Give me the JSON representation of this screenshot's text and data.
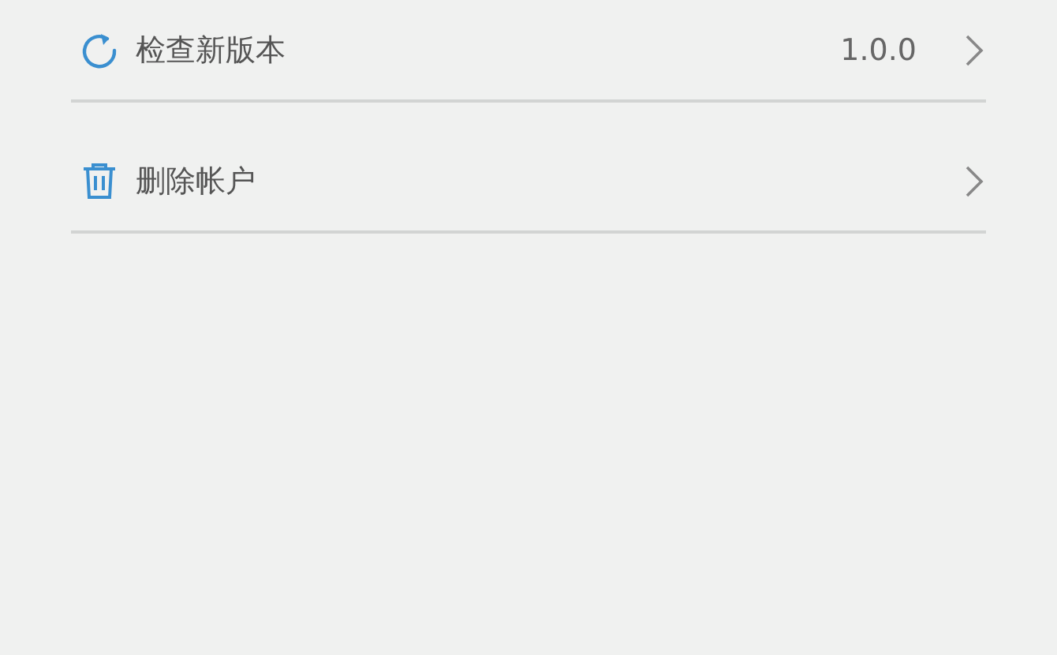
{
  "settings": [
    {
      "kind": "update",
      "label": "检查新版本",
      "value": "1.0.0"
    },
    {
      "kind": "delete",
      "label": "删除帐户"
    }
  ]
}
